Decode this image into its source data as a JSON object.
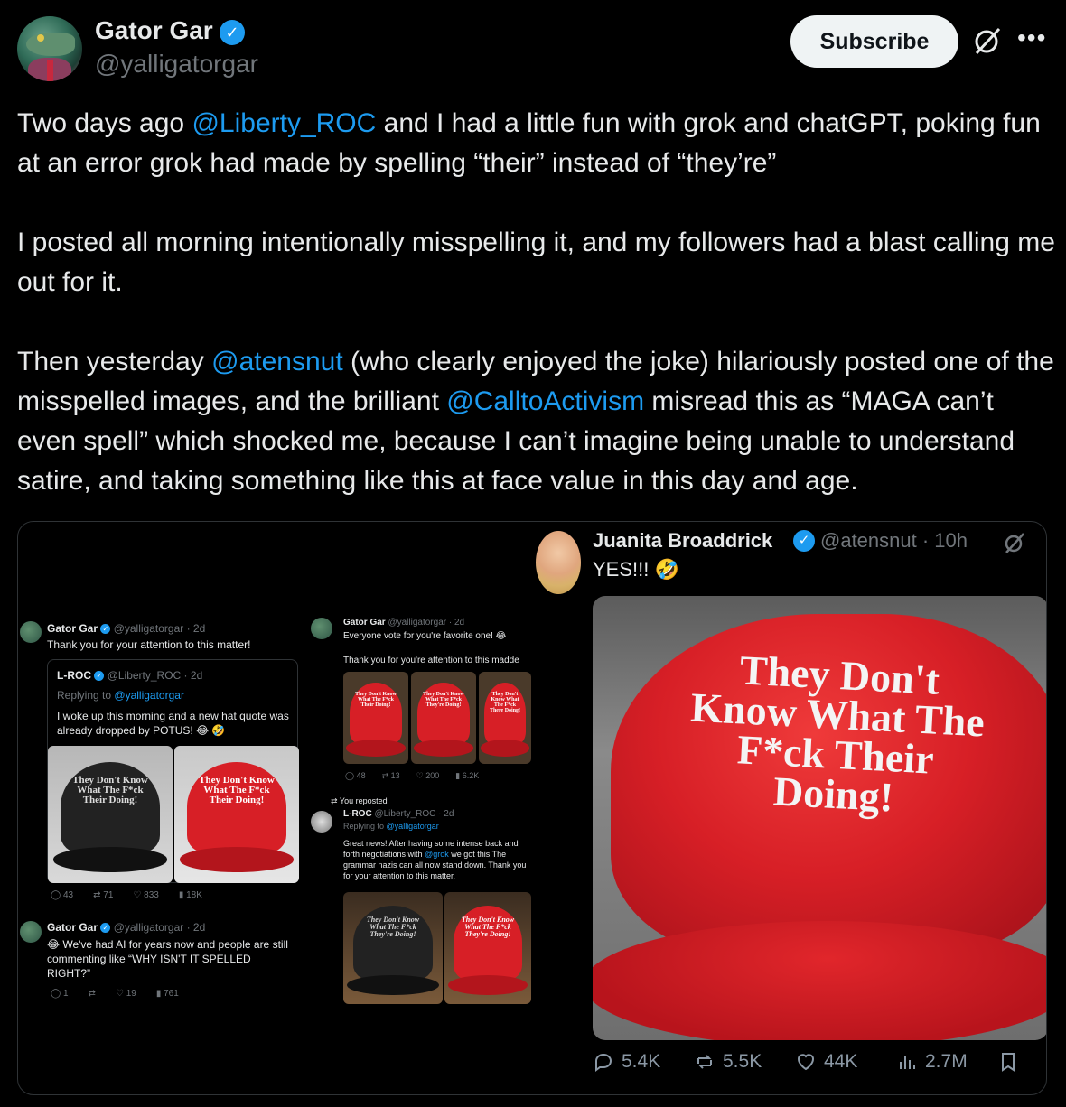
{
  "author": {
    "name": "Gator Gar",
    "handle": "@yalligatorgar",
    "verified_badge": "verified-badge",
    "avatar": "gator-in-suit-avatar"
  },
  "header": {
    "subscribe_label": "Subscribe",
    "grok_icon": "grok-icon",
    "more_icon": "more-icon"
  },
  "tweet": {
    "p1_pre": "Two days ago ",
    "p1_mention": "@Liberty_ROC",
    "p1_post": " and I had a little fun with grok and chatGPT, poking fun at an error grok had made by spelling “their” instead of “they’re”",
    "p2": "I posted all morning intentionally misspelling it, and my followers had a blast calling me out for it.",
    "p3_pre": "Then yesterday ",
    "p3_mention1": "@atensnut",
    "p3_mid1": " (who clearly enjoyed the joke) hilariously posted one of the misspelled images, and the brilliant ",
    "p3_mention2": "@CalltoActivism",
    "p3_post": " misread this as “MAGA can’t even spell” which shocked me, because I can’t imagine being unable to understand satire, and taking something like this at face value in this day and age."
  },
  "media": {
    "left_post1": {
      "name": "Gator Gar",
      "meta": "@yalligatorgar · 2d",
      "text": "Thank you for your attention to this matter!",
      "quote": {
        "name": "L-ROC",
        "meta": "@Liberty_ROC · 2d",
        "replying": "Replying to",
        "replying_handle": "@yalligatorgar",
        "text": "I woke up this morning and a new hat quote was already dropped by POTUS! 😂 🤣",
        "hat_text_a": "They Don't Know What The F*ck Their Doing!",
        "hat_text_b": "They Don't Know What The F*ck Their Doing!"
      },
      "stats": [
        "43",
        "71",
        "833",
        "18K"
      ]
    },
    "left_post2": {
      "name": "Gator Gar",
      "meta": "@yalligatorgar · 2d",
      "text": "😂 We've had AI for years now and people are still commenting like “WHY ISN'T IT SPELLED RIGHT?”",
      "stats": [
        "1",
        "",
        "19",
        "761"
      ]
    },
    "mid_post1": {
      "name": "Gator Gar",
      "meta": "@yalligatorgar · 2d",
      "text": "Everyone vote for you're favorite one! 😂",
      "text2": "Thank you for you're attention to this madde",
      "hat1": "They Don't Know What The F*ck Their Doing!",
      "hat2": "They Don't Know What The F*ck They're Doing!",
      "hat3": "They Don't Know What The F*ck There Doing!",
      "stats": [
        "48",
        "13",
        "200",
        "6.2K"
      ]
    },
    "mid_post2": {
      "reposted": "You reposted",
      "name": "L-ROC",
      "meta": "@Liberty_ROC · 2d",
      "replying": "Replying to",
      "replying_handle": "@yalligatorgar",
      "text_pre": "Great news! After having some intense back and forth negotiations with ",
      "text_mention": "@grok",
      "text_post": " we got this The grammar nazis can all now stand down. Thank you for your attention to this matter.",
      "hat_a": "They Don't Know What The F*ck They're Doing!",
      "hat_b": "They Don't Know What The F*ck They're Doing!"
    },
    "right_post": {
      "name": "Juanita Broaddrick",
      "meta": "@atensnut · 10h",
      "text": "YES!!! 🤣",
      "hat_text": "They Don't Know What The F*ck Their Doing!",
      "stats": {
        "replies": "5.4K",
        "reposts": "5.5K",
        "likes": "44K",
        "views": "2.7M"
      }
    }
  },
  "colors": {
    "background": "#000000",
    "text": "#e7e9ea",
    "muted": "#71767b",
    "link": "#1d9bf0",
    "hat_red": "#d71f26"
  }
}
